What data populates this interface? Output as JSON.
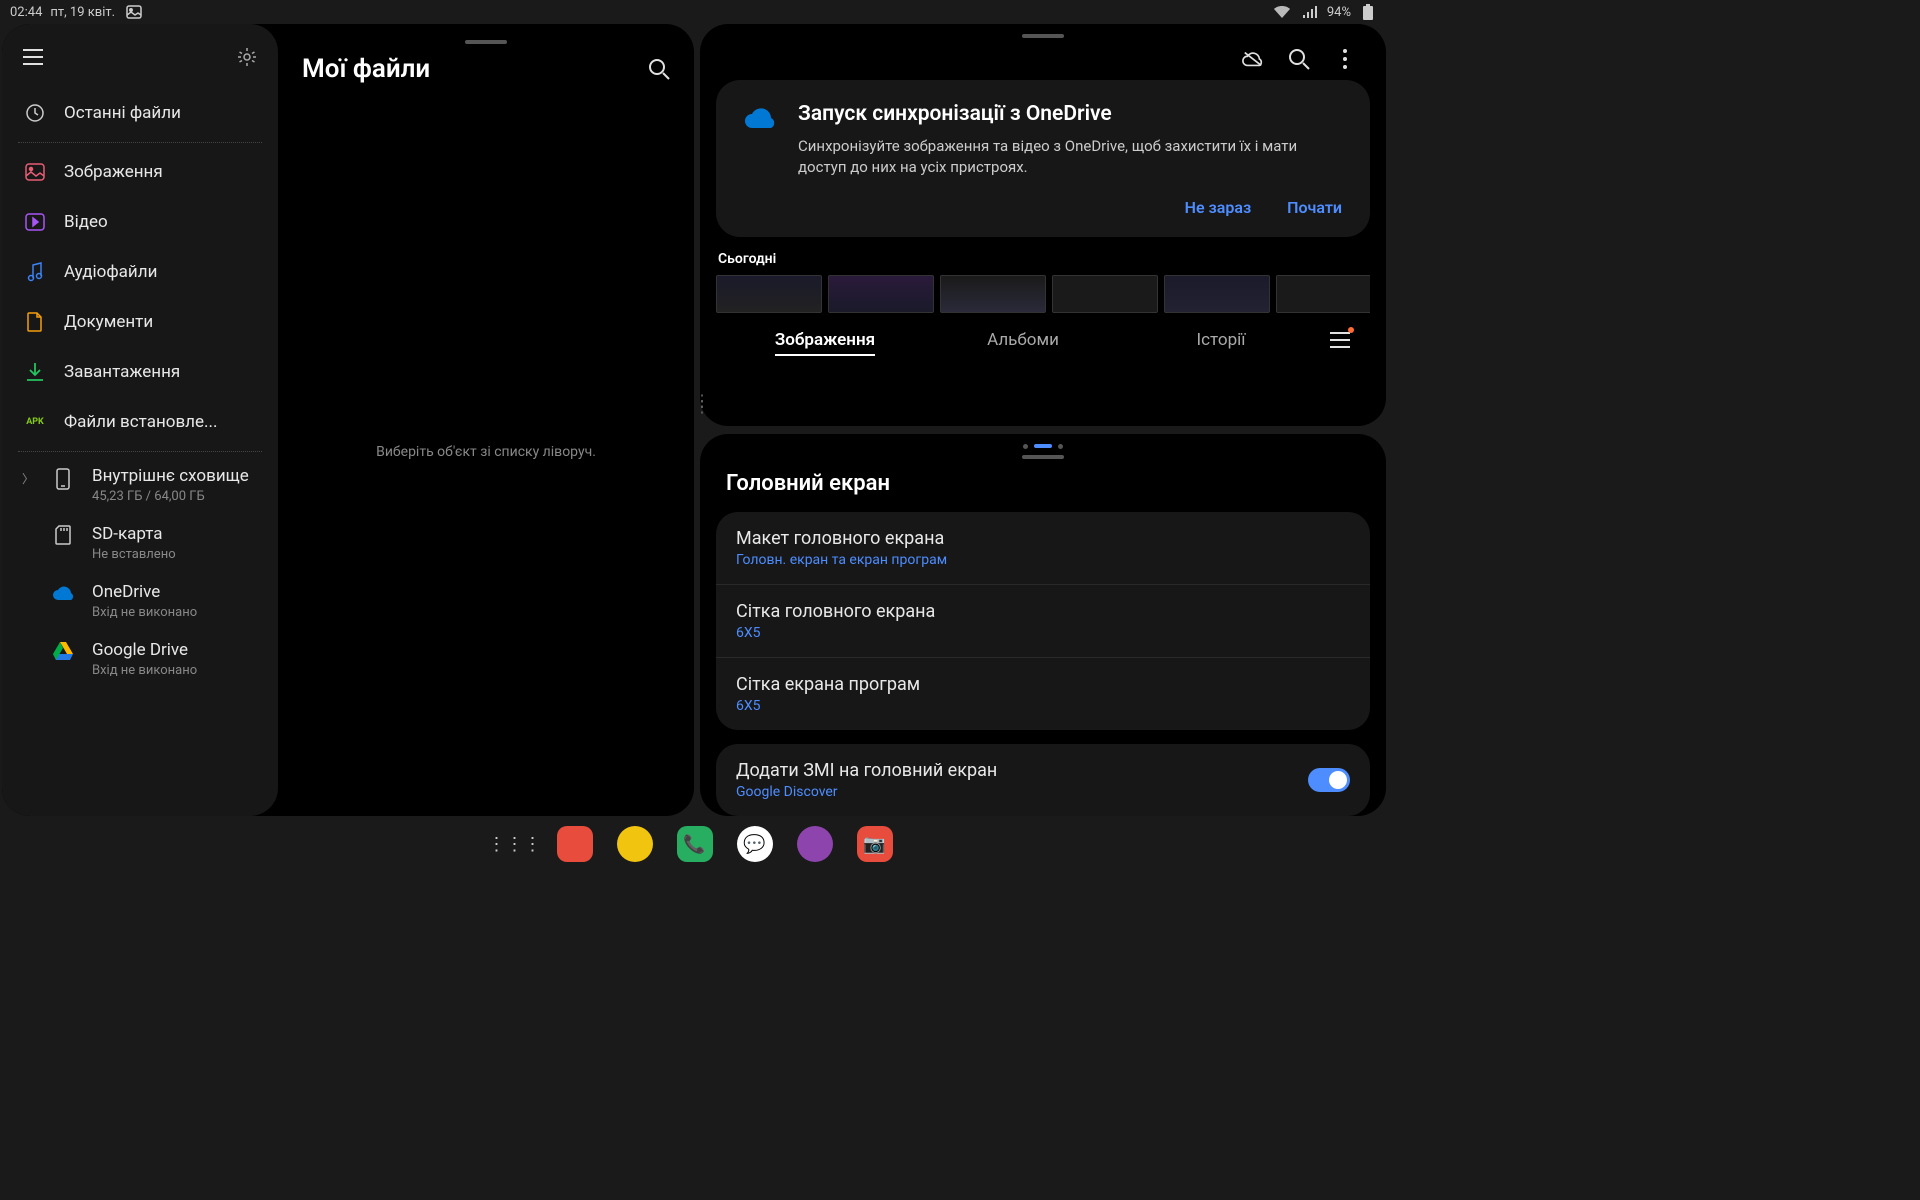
{
  "status": {
    "time": "02:44",
    "date": "пт, 19 квіт.",
    "battery": "94%"
  },
  "files": {
    "title": "Мої файли",
    "empty": "Виберіть об'єкт зі списку ліворуч.",
    "sidebar": {
      "recent": "Останні файли",
      "images": "Зображення",
      "video": "Відео",
      "audio": "Аудіофайли",
      "docs": "Документи",
      "downloads": "Завантаження",
      "apk_badge": "APK",
      "apk": "Файли встановле...",
      "internal": "Внутрішнє сховище",
      "internal_sub": "45,23 ГБ / 64,00 ГБ",
      "sd": "SD-карта",
      "sd_sub": "Не вставлено",
      "onedrive": "OneDrive",
      "onedrive_sub": "Вхід не виконано",
      "gdrive": "Google Drive",
      "gdrive_sub": "Вхід не виконано"
    }
  },
  "gallery": {
    "od_title": "Запуск синхронізації з OneDrive",
    "od_desc": "Синхронізуйте зображення та відео з OneDrive, щоб захистити їх і мати доступ до них на усіх пристроях.",
    "not_now": "Не зараз",
    "start": "Почати",
    "today": "Сьогодні",
    "tab_images": "Зображення",
    "tab_albums": "Альбоми",
    "tab_stories": "Історії"
  },
  "settings": {
    "title": "Головний екран",
    "layout": "Макет головного екрана",
    "layout_sub": "Головн. екран та екран програм",
    "home_grid": "Сітка головного екрана",
    "home_grid_sub": "6X5",
    "apps_grid": "Сітка екрана програм",
    "apps_grid_sub": "6X5",
    "media": "Додати ЗМІ на головний екран",
    "media_sub": "Google Discover"
  }
}
